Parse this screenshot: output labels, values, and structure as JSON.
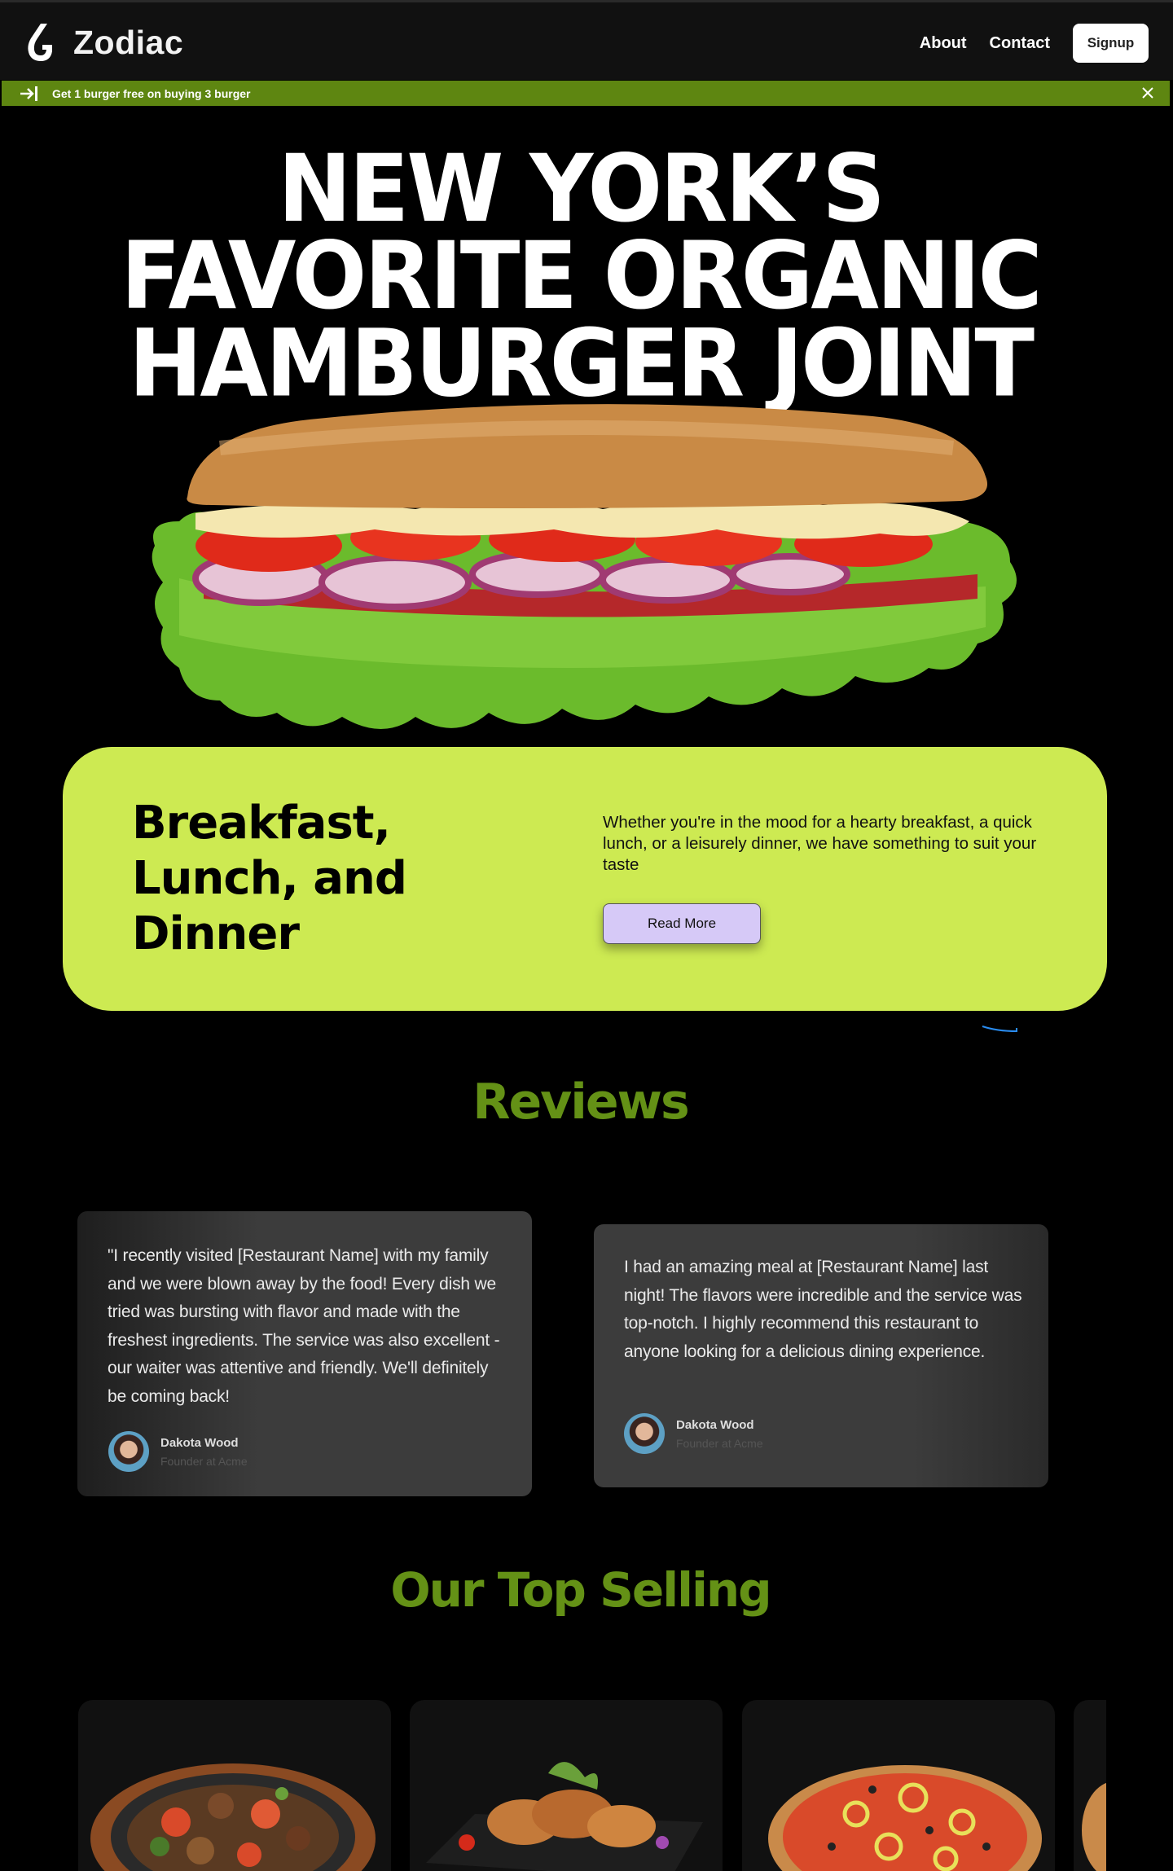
{
  "nav": {
    "logo_text": "Zodiac",
    "links": [
      "About",
      "Contact"
    ],
    "signup_label": "Signup"
  },
  "promo": {
    "text": "Get 1 burger free on buying 3 burger"
  },
  "hero": {
    "title_lines": [
      "NEW YORK’S",
      "FAVORITE ORGANIC",
      "HAMBURGER JOINT"
    ]
  },
  "meal_card": {
    "heading_lines": [
      "Breakfast,",
      "Lunch, and",
      "Dinner"
    ],
    "description": "Whether you're in the mood for a hearty breakfast, a quick lunch, or a leisurely dinner, we have something to suit your taste",
    "button_label": "Read More"
  },
  "reviews": {
    "title": "Reviews",
    "items": [
      {
        "text": "\"I recently visited [Restaurant Name] with my family and we were blown away by the food! Every dish we tried was bursting with flavor and made with the freshest ingredients. The service was also excellent - our waiter was attentive and friendly. We'll definitely be coming back!",
        "name": "Dakota Wood",
        "role": "Founder at Acme"
      },
      {
        "text": "I had an amazing meal at [Restaurant Name] last night! The flavors were incredible and the service was top-notch. I highly recommend this restaurant to anyone looking for a delicious dining experience.",
        "name": "Dakota Wood",
        "role": "Founder at Acme"
      }
    ]
  },
  "top_selling": {
    "title": "Our Top Selling"
  },
  "colors": {
    "promo_green": "#5e8611",
    "card_lime": "#cdea52",
    "section_green": "#649116",
    "button_lavender": "#d6c9f7"
  }
}
